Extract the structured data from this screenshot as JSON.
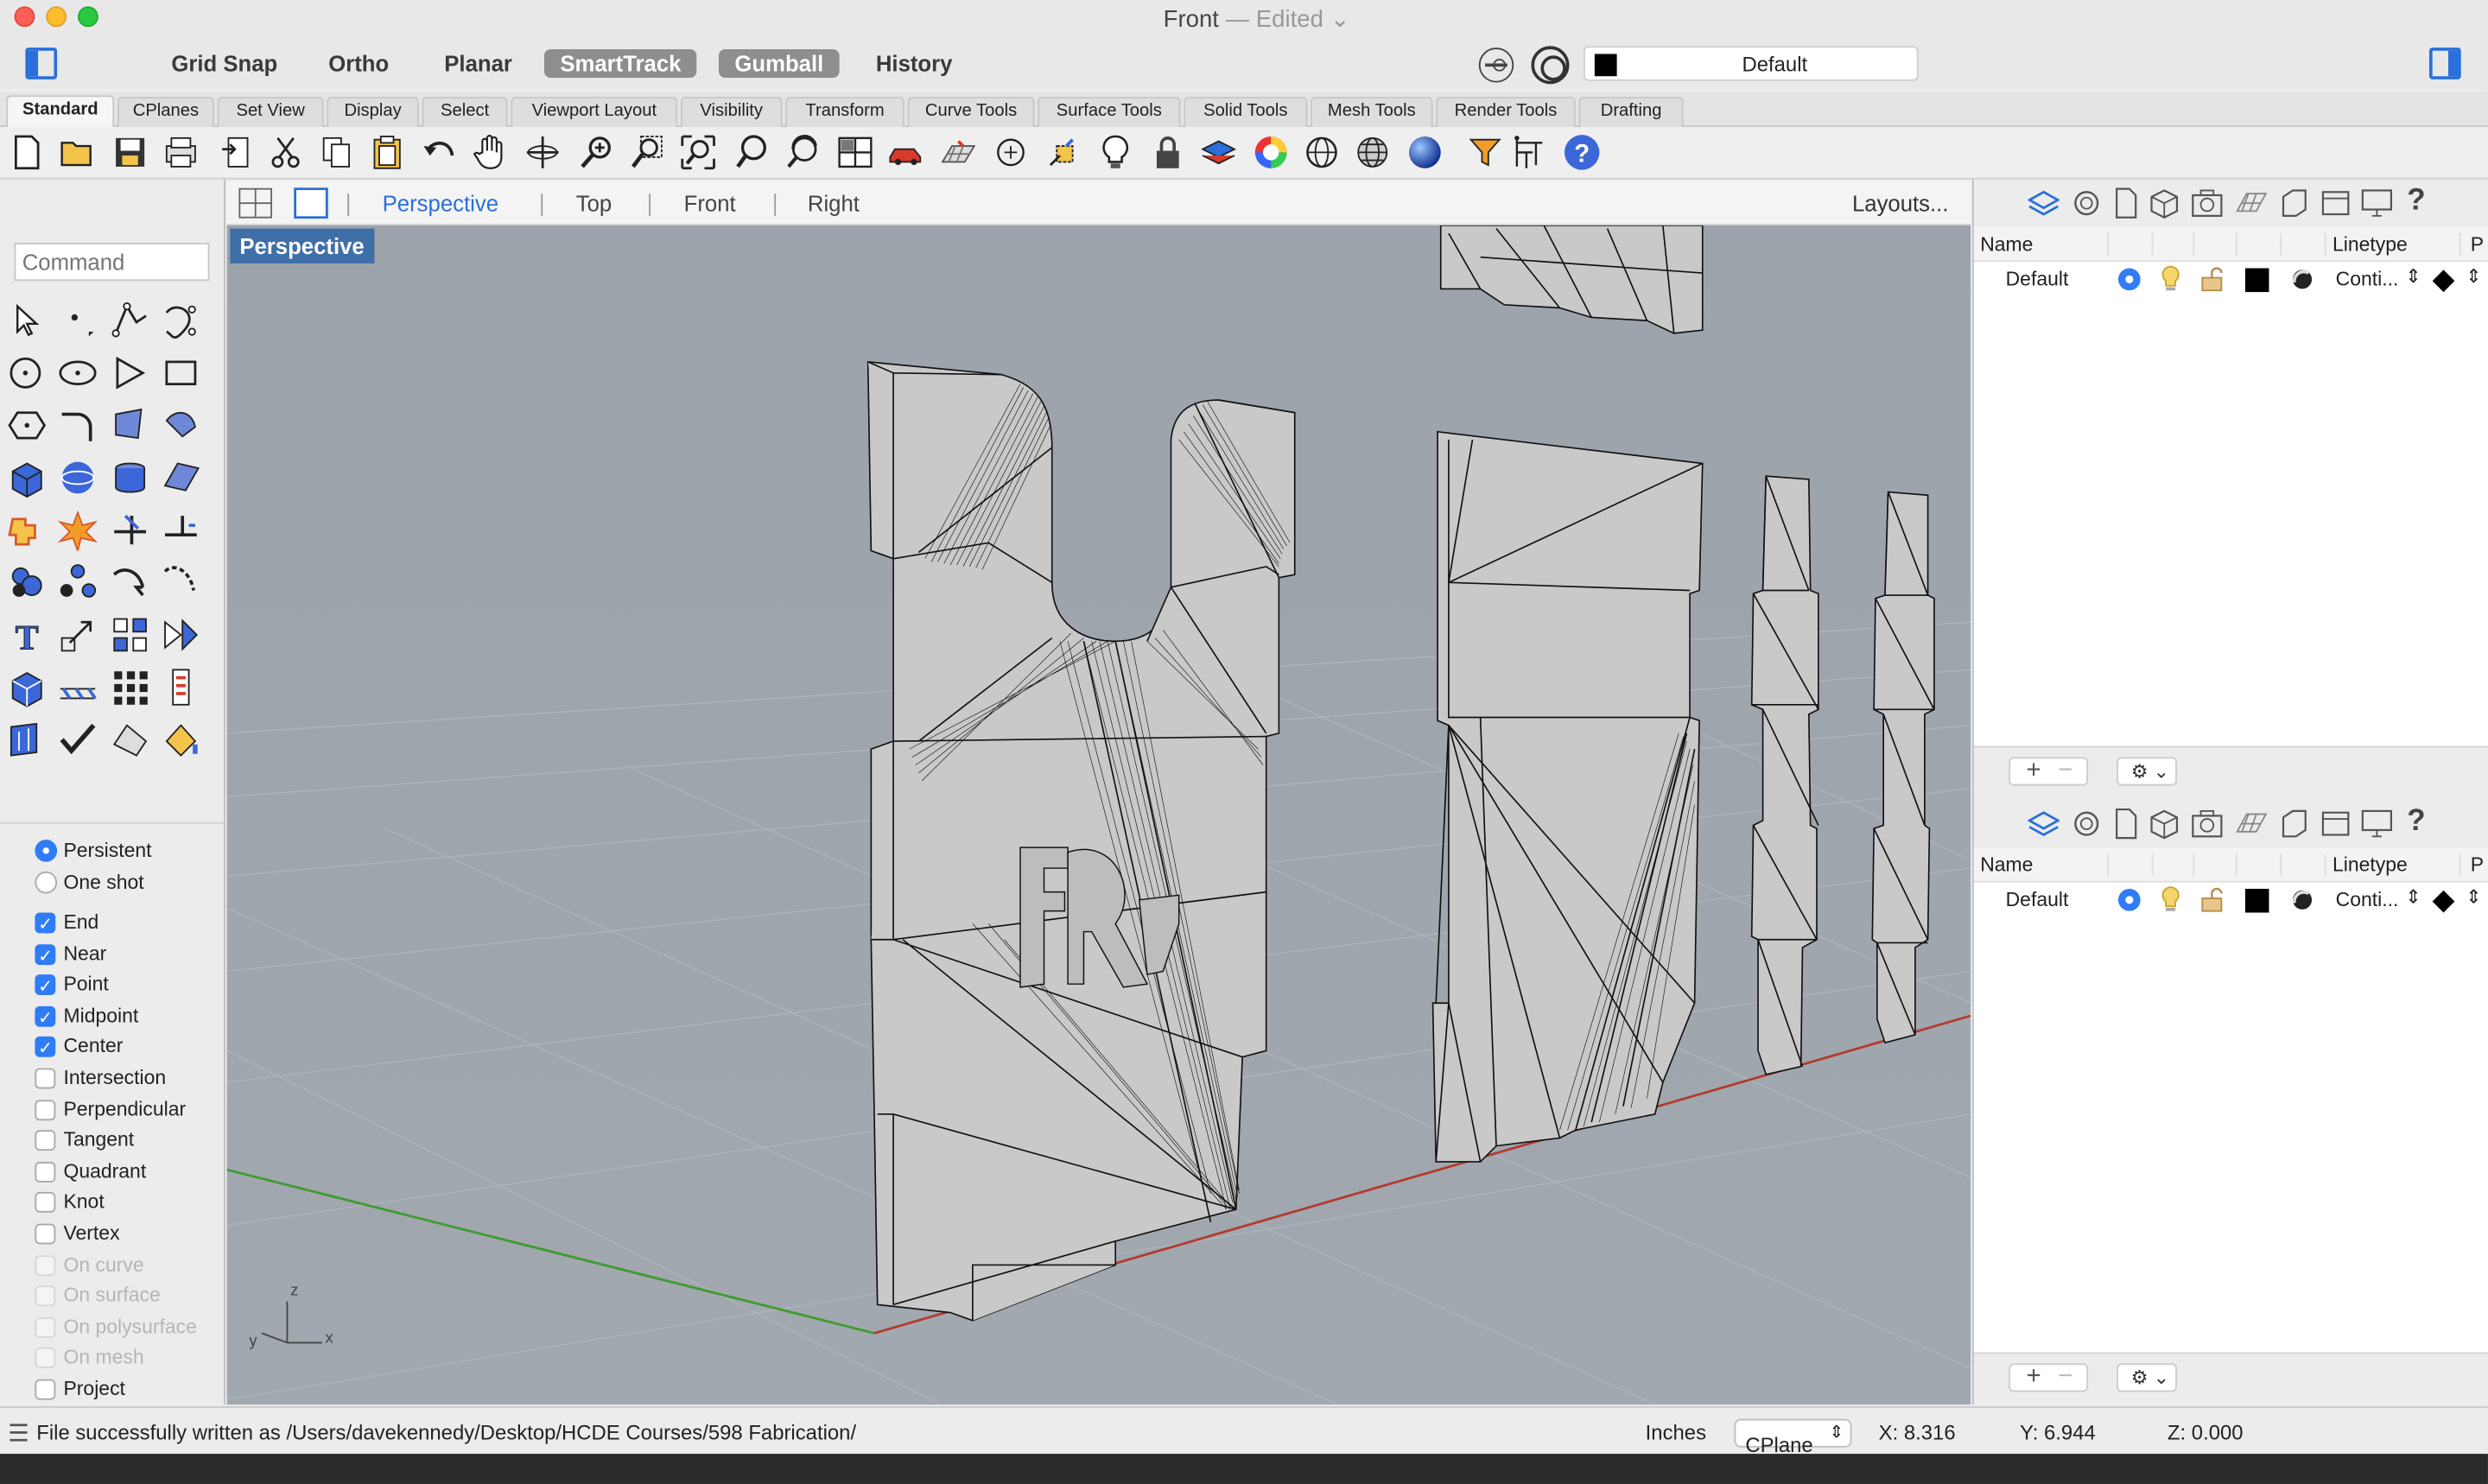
{
  "window": {
    "title": "Front",
    "title_sep": " — ",
    "title_status": "Edited"
  },
  "toolbar": {
    "modes": [
      {
        "label": "Grid Snap",
        "active": false
      },
      {
        "label": "Ortho",
        "active": false
      },
      {
        "label": "Planar",
        "active": false
      },
      {
        "label": "SmartTrack",
        "active": true
      },
      {
        "label": "Gumball",
        "active": true
      },
      {
        "label": "History",
        "active": false
      }
    ],
    "layer_dropdown": "Default",
    "layer_color": "#000000"
  },
  "tabs": [
    "Standard",
    "CPlanes",
    "Set View",
    "Display",
    "Select",
    "Viewport Layout",
    "Visibility",
    "Transform",
    "Curve Tools",
    "Surface Tools",
    "Solid Tools",
    "Mesh Tools",
    "Render Tools",
    "Drafting"
  ],
  "tool_icons": [
    "new-file-icon",
    "open-folder-icon",
    "save-icon",
    "print-icon",
    "import-icon",
    "cut-icon",
    "copy-icon",
    "paste-icon",
    "undo-icon",
    "pan-hand-icon",
    "rotate-view-icon",
    "zoom-icon",
    "zoom-window-icon",
    "zoom-extents-icon",
    "zoom-selected-icon",
    "rotate-camera-icon",
    "four-viewports-icon",
    "car-render-icon",
    "grid-icon",
    "object-snap-icon",
    "gumball-icon",
    "light-icon",
    "lock-icon",
    "layer-icon",
    "color-wheel-icon",
    "sphere-wireframe-icon",
    "sphere-shaded-icon",
    "sphere-render-icon",
    "filter-icon",
    "dimension-icon",
    "help-icon"
  ],
  "command": {
    "placeholder": "Command"
  },
  "osnap_mode": [
    {
      "label": "Persistent",
      "selected": true
    },
    {
      "label": "One shot",
      "selected": false
    }
  ],
  "osnaps": [
    {
      "label": "End",
      "checked": true,
      "enabled": true
    },
    {
      "label": "Near",
      "checked": true,
      "enabled": true
    },
    {
      "label": "Point",
      "checked": true,
      "enabled": true
    },
    {
      "label": "Midpoint",
      "checked": true,
      "enabled": true
    },
    {
      "label": "Center",
      "checked": true,
      "enabled": true
    },
    {
      "label": "Intersection",
      "checked": false,
      "enabled": true
    },
    {
      "label": "Perpendicular",
      "checked": false,
      "enabled": true
    },
    {
      "label": "Tangent",
      "checked": false,
      "enabled": true
    },
    {
      "label": "Quadrant",
      "checked": false,
      "enabled": true
    },
    {
      "label": "Knot",
      "checked": false,
      "enabled": true
    },
    {
      "label": "Vertex",
      "checked": false,
      "enabled": true
    },
    {
      "label": "On curve",
      "checked": false,
      "enabled": false
    },
    {
      "label": "On surface",
      "checked": false,
      "enabled": false
    },
    {
      "label": "On polysurface",
      "checked": false,
      "enabled": false
    },
    {
      "label": "On mesh",
      "checked": false,
      "enabled": false
    },
    {
      "label": "Project",
      "checked": false,
      "enabled": true
    }
  ],
  "viewport": {
    "tabs": [
      "Perspective",
      "Top",
      "Front",
      "Right"
    ],
    "active_tab": "Perspective",
    "layouts_label": "Layouts...",
    "label": "Perspective",
    "axes": {
      "z": "z",
      "x": "x",
      "y": "y"
    }
  },
  "layers_panel": {
    "columns": {
      "name": "Name",
      "linetype": "Linetype",
      "print": "P"
    },
    "rows": [
      {
        "name": "Default",
        "linetype": "Conti...",
        "color": "#000000"
      }
    ]
  },
  "status": {
    "message": "File successfully written as /Users/davekennedy/Desktop/HCDE Courses/598 Fabrication/",
    "units": "Inches",
    "cplane": "CPlane",
    "x": "X: 8.316",
    "y": "Y: 6.944",
    "z": "Z: 0.000"
  }
}
